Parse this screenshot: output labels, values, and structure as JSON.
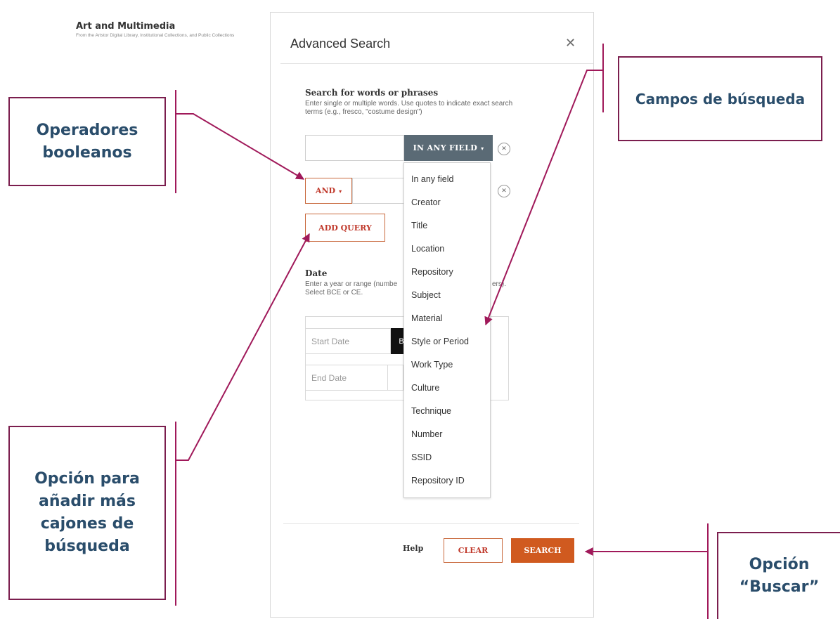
{
  "header": {
    "title": "Art and Multimedia",
    "subtitle": "From the Artstor Digital Library, Institutional Collections, and Public Collections"
  },
  "modal": {
    "title": "Advanced Search",
    "close_icon": "close-icon",
    "search_section": {
      "title": "Search for words or phrases",
      "help": "Enter single or multiple words. Use quotes to indicate exact search terms (e.g., fresco, \"costume design\")"
    },
    "query_rows": [
      {
        "field_label": "IN ANY FIELD",
        "value": ""
      },
      {
        "operator_label": "AND",
        "value": ""
      }
    ],
    "field_dropdown_caret": "▾",
    "operator_caret": "▾",
    "remove_icon": "⊗",
    "add_query_label": "ADD QUERY",
    "field_options": [
      "In any field",
      "Creator",
      "Title",
      "Location",
      "Repository",
      "Subject",
      "Material",
      "Style or Period",
      "Work Type",
      "Culture",
      "Technique",
      "Number",
      "SSID",
      "Repository ID"
    ],
    "date_section": {
      "title": "Date",
      "help_line1": "Enter a year or range (numbe",
      "help_line1_end": "ers).",
      "help_line2": "Select BCE or CE.",
      "start_placeholder": "Start Date",
      "end_placeholder": "End Date",
      "era_partial": "B"
    },
    "footer": {
      "help_label": "Help",
      "clear_label": "CLEAR",
      "search_label": "SEARCH"
    }
  },
  "annotations": {
    "operadores": [
      "Operadores",
      "booleanos"
    ],
    "campos": "Campos de búsqueda",
    "opcion_anadir": [
      "Opción para",
      "añadir más",
      "cajones de",
      "búsqueda"
    ],
    "opcion_buscar": [
      "Opción",
      "“Buscar”"
    ]
  },
  "colors": {
    "accent": "#d05a1f",
    "accent_text": "#c0392b",
    "field_dropdown_bg": "#5a6a75",
    "annotation_border": "#7b1e4e",
    "annotation_text": "#2a4d6b"
  }
}
